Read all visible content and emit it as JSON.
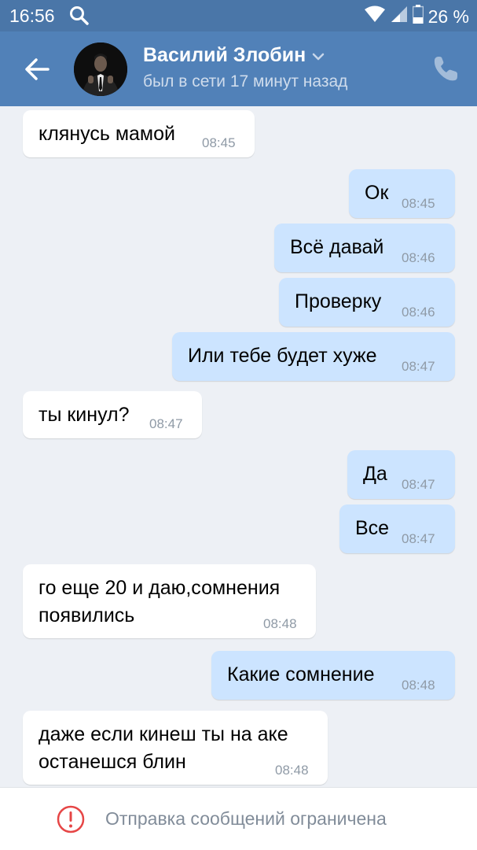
{
  "status_bar": {
    "time": "16:56",
    "battery": "26 %",
    "icons": [
      "search-icon",
      "wifi-icon",
      "signal-icon",
      "battery-icon"
    ]
  },
  "header": {
    "name": "Василий Злобин",
    "subtitle": "был в сети 17 минут назад",
    "icons": [
      "back-arrow-icon",
      "chevron-down-icon",
      "phone-icon"
    ]
  },
  "messages": [
    {
      "dir": "in",
      "text": "клянусь мамой",
      "time": "08:45"
    },
    {
      "dir": "out",
      "text": "Ок",
      "time": "08:45"
    },
    {
      "dir": "out",
      "text": "Всё давай",
      "time": "08:46"
    },
    {
      "dir": "out",
      "text": "Проверку",
      "time": "08:46"
    },
    {
      "dir": "out",
      "text": "Или тебе будет хуже",
      "time": "08:47"
    },
    {
      "dir": "in",
      "text": "ты кинул?",
      "time": "08:47"
    },
    {
      "dir": "out",
      "text": "Да",
      "time": "08:47"
    },
    {
      "dir": "out",
      "text": "Все",
      "time": "08:47"
    },
    {
      "dir": "in",
      "line1": "го еще 20 и даю,сомнения",
      "line2": "появились",
      "time": "08:48"
    },
    {
      "dir": "out",
      "text": "Какие сомнение",
      "time": "08:48"
    },
    {
      "dir": "in",
      "line1": "даже если кинеш ты на аке",
      "line2": "останешся блин",
      "time": "08:48"
    }
  ],
  "footer": {
    "notice": "Отправка сообщений ограничена",
    "icon": "warning-icon",
    "accent": "#e64646"
  },
  "colors": {
    "header": "#5181b8",
    "status_bar": "#4a76a8",
    "chat_background": "#edf0f5",
    "incoming_bubble": "#ffffff",
    "outgoing_bubble": "#cce4ff"
  }
}
